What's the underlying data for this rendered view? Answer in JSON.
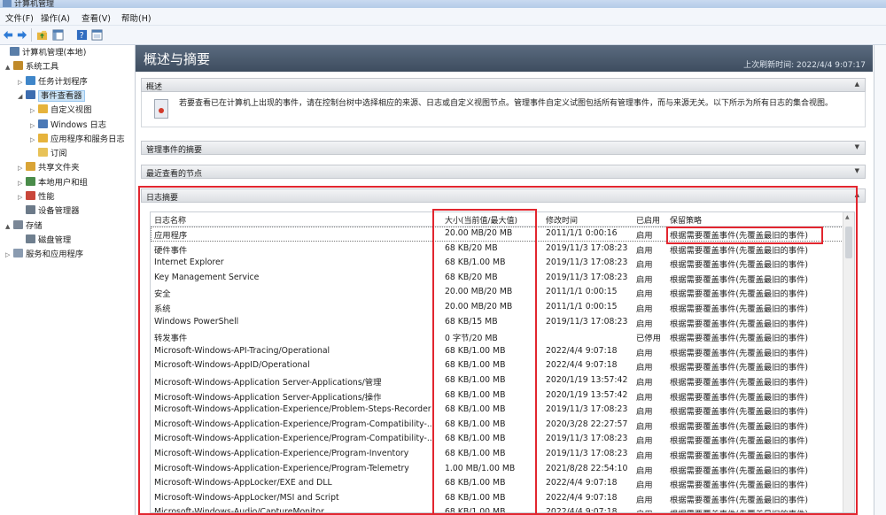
{
  "window": {
    "title": "计算机管理"
  },
  "menu": [
    "文件(F)",
    "操作(A)",
    "查看(V)",
    "帮助(H)"
  ],
  "toolbar": {
    "icons": [
      "back-arrow-icon",
      "forward-arrow-icon",
      "folder-up-icon",
      "console-tree-icon",
      "help-icon",
      "view-icon"
    ]
  },
  "tree": [
    {
      "label": "计算机管理(本地)",
      "level": 0,
      "icon": "computer-management-icon"
    },
    {
      "label": "系统工具",
      "level": 1,
      "icon": "tools-icon",
      "expander": "▲"
    },
    {
      "label": "任务计划程序",
      "level": 2,
      "icon": "clock-icon",
      "expander": "▷"
    },
    {
      "label": "事件查看器",
      "level": 2,
      "icon": "event-viewer-icon",
      "expander": "◢",
      "selected": true
    },
    {
      "label": "自定义视图",
      "level": 3,
      "icon": "folder-icon",
      "expander": "▷"
    },
    {
      "label": "Windows 日志",
      "level": 3,
      "icon": "log-icon",
      "expander": "▷"
    },
    {
      "label": "应用程序和服务日志",
      "level": 3,
      "icon": "folder-icon",
      "expander": "▷"
    },
    {
      "label": "订阅",
      "level": 3,
      "icon": "subscription-icon"
    },
    {
      "label": "共享文件夹",
      "level": 2,
      "icon": "shared-folder-icon",
      "expander": "▷"
    },
    {
      "label": "本地用户和组",
      "level": 2,
      "icon": "users-icon",
      "expander": "▷"
    },
    {
      "label": "性能",
      "level": 2,
      "icon": "performance-icon",
      "expander": "▷"
    },
    {
      "label": "设备管理器",
      "level": 2,
      "icon": "device-manager-icon"
    },
    {
      "label": "存储",
      "level": 1,
      "icon": "storage-icon",
      "expander": "▲"
    },
    {
      "label": "磁盘管理",
      "level": 2,
      "icon": "disk-icon"
    },
    {
      "label": "服务和应用程序",
      "level": 1,
      "icon": "services-icon",
      "expander": "▷"
    }
  ],
  "main": {
    "header_title": "概述与摘要",
    "refresh_text": "上次刷新时间: 2022/4/4 9:07:17",
    "sections": [
      "概述",
      "管理事件的摘要",
      "最近查看的节点",
      "日志摘要"
    ],
    "overview_text": "若要查看已在计算机上出现的事件，请在控制台树中选择相应的来源、日志或自定义视图节点。管理事件自定义试图包括所有管理事件，而与来源无关。以下所示为所有日志的集合视图。"
  },
  "log_table": {
    "columns": [
      "日志名称",
      "大小(当前值/最大值)",
      "修改时间",
      "已启用",
      "保留策略"
    ],
    "rows": [
      [
        "应用程序",
        "20.00 MB/20 MB",
        "2011/1/1 0:00:16",
        "启用",
        "根据需要覆盖事件(先覆盖最旧的事件)"
      ],
      [
        "硬件事件",
        "68 KB/20 MB",
        "2019/11/3 17:08:23",
        "启用",
        "根据需要覆盖事件(先覆盖最旧的事件)"
      ],
      [
        "Internet Explorer",
        "68 KB/1.00 MB",
        "2019/11/3 17:08:23",
        "启用",
        "根据需要覆盖事件(先覆盖最旧的事件)"
      ],
      [
        "Key Management Service",
        "68 KB/20 MB",
        "2019/11/3 17:08:23",
        "启用",
        "根据需要覆盖事件(先覆盖最旧的事件)"
      ],
      [
        "安全",
        "20.00 MB/20 MB",
        "2011/1/1 0:00:15",
        "启用",
        "根据需要覆盖事件(先覆盖最旧的事件)"
      ],
      [
        "系统",
        "20.00 MB/20 MB",
        "2011/1/1 0:00:15",
        "启用",
        "根据需要覆盖事件(先覆盖最旧的事件)"
      ],
      [
        "Windows PowerShell",
        "68 KB/15 MB",
        "2019/11/3 17:08:23",
        "启用",
        "根据需要覆盖事件(先覆盖最旧的事件)"
      ],
      [
        "转发事件",
        "0 字节/20 MB",
        "",
        "已停用",
        "根据需要覆盖事件(先覆盖最旧的事件)"
      ],
      [
        "Microsoft-Windows-API-Tracing/Operational",
        "68 KB/1.00 MB",
        "2022/4/4 9:07:18",
        "启用",
        "根据需要覆盖事件(先覆盖最旧的事件)"
      ],
      [
        "Microsoft-Windows-AppID/Operational",
        "68 KB/1.00 MB",
        "2022/4/4 9:07:18",
        "启用",
        "根据需要覆盖事件(先覆盖最旧的事件)"
      ],
      [
        "Microsoft-Windows-Application Server-Applications/管理",
        "68 KB/1.00 MB",
        "2020/1/19 13:57:42",
        "启用",
        "根据需要覆盖事件(先覆盖最旧的事件)"
      ],
      [
        "Microsoft-Windows-Application Server-Applications/操作",
        "68 KB/1.00 MB",
        "2020/1/19 13:57:42",
        "启用",
        "根据需要覆盖事件(先覆盖最旧的事件)"
      ],
      [
        "Microsoft-Windows-Application-Experience/Problem-Steps-Recorder",
        "68 KB/1.00 MB",
        "2019/11/3 17:08:23",
        "启用",
        "根据需要覆盖事件(先覆盖最旧的事件)"
      ],
      [
        "Microsoft-Windows-Application-Experience/Program-Compatibility-...",
        "68 KB/1.00 MB",
        "2020/3/28 22:27:57",
        "启用",
        "根据需要覆盖事件(先覆盖最旧的事件)"
      ],
      [
        "Microsoft-Windows-Application-Experience/Program-Compatibility-...",
        "68 KB/1.00 MB",
        "2019/11/3 17:08:23",
        "启用",
        "根据需要覆盖事件(先覆盖最旧的事件)"
      ],
      [
        "Microsoft-Windows-Application-Experience/Program-Inventory",
        "68 KB/1.00 MB",
        "2019/11/3 17:08:23",
        "启用",
        "根据需要覆盖事件(先覆盖最旧的事件)"
      ],
      [
        "Microsoft-Windows-Application-Experience/Program-Telemetry",
        "1.00 MB/1.00 MB",
        "2021/8/28 22:54:10",
        "启用",
        "根据需要覆盖事件(先覆盖最旧的事件)"
      ],
      [
        "Microsoft-Windows-AppLocker/EXE and DLL",
        "68 KB/1.00 MB",
        "2022/4/4 9:07:18",
        "启用",
        "根据需要覆盖事件(先覆盖最旧的事件)"
      ],
      [
        "Microsoft-Windows-AppLocker/MSI and Script",
        "68 KB/1.00 MB",
        "2022/4/4 9:07:18",
        "启用",
        "根据需要覆盖事件(先覆盖最旧的事件)"
      ],
      [
        "Microsoft-Windows-Audio/CaptureMonitor",
        "68 KB/1.00 MB",
        "2022/4/4 9:07:18",
        "启用",
        "根据需要覆盖事件(先覆盖最旧的事件)"
      ]
    ]
  },
  "colors": {
    "highlight_box": "#e2262f",
    "header_bg": "#4b5b6e",
    "selected_bg": "#cce4f7"
  }
}
